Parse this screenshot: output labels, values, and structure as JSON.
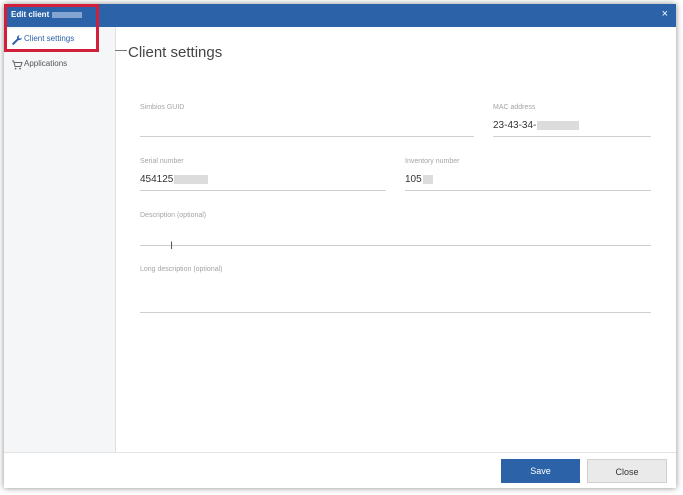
{
  "window": {
    "title": "Edit client",
    "close_glyph": "×"
  },
  "sidebar": {
    "items": [
      {
        "label": "Client settings",
        "icon": "wrench-icon",
        "active": true
      },
      {
        "label": "Applications",
        "icon": "cart-icon",
        "active": false
      }
    ]
  },
  "main": {
    "section_title": "Client settings"
  },
  "form": {
    "simbios_guid": {
      "label": "Simbios GUID",
      "value": ""
    },
    "mac_address": {
      "label": "MAC address",
      "value": "23-43-34-"
    },
    "serial_number": {
      "label": "Serial number",
      "value": "454125"
    },
    "inventory_number": {
      "label": "Inventory number",
      "value": "105"
    },
    "description": {
      "label": "Description (optional)",
      "value": ""
    },
    "long_description": {
      "label": "Long description (optional)",
      "value": ""
    }
  },
  "footer": {
    "save_label": "Save",
    "close_label": "Close"
  },
  "colors": {
    "accent": "#2b62a8",
    "highlight": "#d21f3c"
  }
}
